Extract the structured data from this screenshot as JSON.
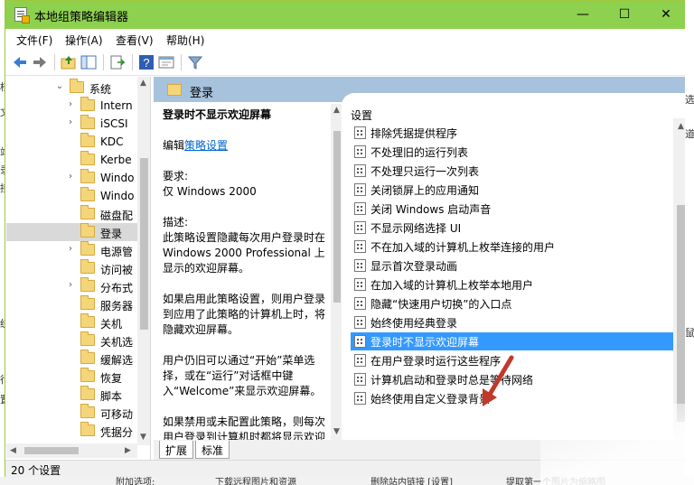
{
  "window": {
    "title": "本地组策略编辑器"
  },
  "menu": [
    "文件(F)",
    "操作(A)",
    "查看(V)",
    "帮助(H)"
  ],
  "tree": [
    {
      "label": "系统",
      "expander": "⌄"
    },
    {
      "label": "Intern",
      "expander": "›"
    },
    {
      "label": "iSCSI",
      "expander": "›"
    },
    {
      "label": "KDC",
      "expander": ""
    },
    {
      "label": "Kerbe",
      "expander": ""
    },
    {
      "label": "Windo",
      "expander": "›"
    },
    {
      "label": "Windo",
      "expander": ""
    },
    {
      "label": "磁盘配",
      "expander": ""
    },
    {
      "label": "登录",
      "expander": "",
      "selected": true
    },
    {
      "label": "电源管",
      "expander": "›"
    },
    {
      "label": "访问被",
      "expander": ""
    },
    {
      "label": "分布式",
      "expander": "›"
    },
    {
      "label": "服务器",
      "expander": ""
    },
    {
      "label": "关机",
      "expander": ""
    },
    {
      "label": "关机选",
      "expander": ""
    },
    {
      "label": "缓解选",
      "expander": ""
    },
    {
      "label": "恢复",
      "expander": ""
    },
    {
      "label": "脚本",
      "expander": ""
    },
    {
      "label": "可移动",
      "expander": ""
    },
    {
      "label": "凭据分",
      "expander": ""
    }
  ],
  "header": {
    "folder_label": "登录"
  },
  "description": {
    "title": "登录时不显示欢迎屏幕",
    "edit_prefix": "编辑",
    "edit_link": "策略设置",
    "requirements_label": "要求:",
    "requirements_value": "仅 Windows 2000",
    "desc_label": "描述:",
    "desc_text": "此策略设置隐藏每次用户登录时在 Windows 2000 Professional 上显示的欢迎屏幕。",
    "para2": "如果启用此策略设置，则用户登录到应用了此策略的计算机上时，将隐藏欢迎屏幕。",
    "para3": "用户仍旧可以通过“开始”菜单选择，或在“运行”对话框中键入“Welcome”来显示欢迎屏幕。",
    "para4": "如果禁用或未配置此策略，则每次用户登录到计算机时都将显示欢迎"
  },
  "settings": {
    "column_header": "设置",
    "items": [
      "排除凭据提供程序",
      "不处理旧的运行列表",
      "不处理只运行一次列表",
      "关闭锁屏上的应用通知",
      "关闭 Windows 启动声音",
      "不显示网络选择 UI",
      "不在加入域的计算机上枚举连接的用户",
      "显示首次登录动画",
      "在加入域的计算机上枚举本地用户",
      "隐藏“快速用户切换”的入口点",
      "始终使用经典登录",
      "登录时不显示欢迎屏幕",
      "在用户登录时运行这些程序",
      "计算机启动和登录时总是等待网络",
      "始终使用自定义登录背景"
    ],
    "selected_index": 11
  },
  "tabs": [
    "扩展",
    "标准"
  ],
  "status": {
    "text": "20 个设置"
  },
  "colors": {
    "titlebar": "#8ed14f",
    "selection": "#3399ff",
    "header_band": "#a7c2dc",
    "arrow": "#c0392b"
  }
}
